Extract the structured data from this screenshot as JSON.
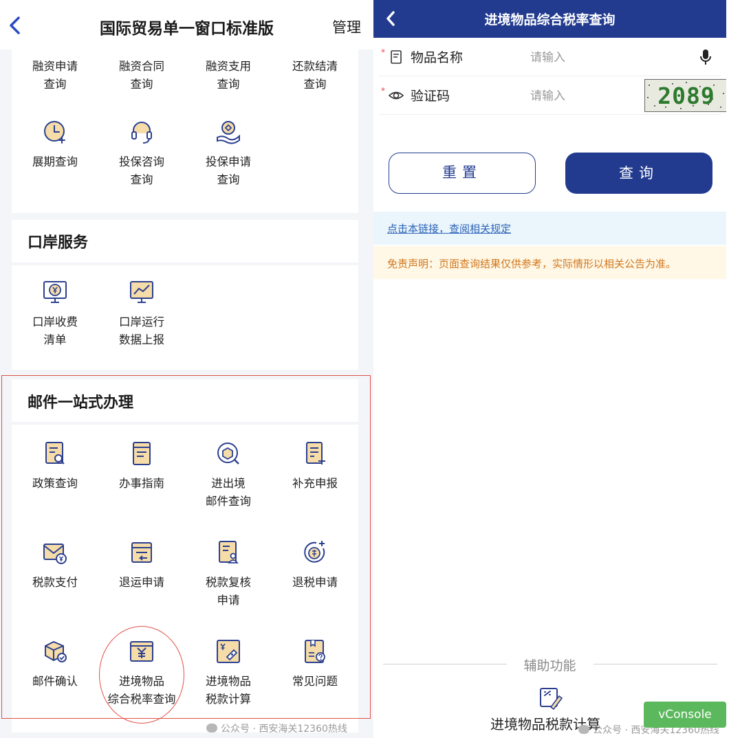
{
  "left": {
    "header": {
      "title": "国际贸易单一窗口标准版",
      "manage": "管理"
    },
    "finance": {
      "text_row": [
        "融资申请\n查询",
        "融资合同\n查询",
        "融资支用\n查询",
        "还款结清\n查询"
      ],
      "icon_row": [
        {
          "label": "展期查询",
          "icon": "clock-plus-icon"
        },
        {
          "label": "投保咨询\n查询",
          "icon": "headset-icon"
        },
        {
          "label": "投保申请\n查询",
          "icon": "hand-coin-icon"
        }
      ]
    },
    "port": {
      "title": "口岸服务",
      "items": [
        {
          "label": "口岸收费\n清单",
          "icon": "monitor-yen-icon"
        },
        {
          "label": "口岸运行\n数据上报",
          "icon": "monitor-chart-icon"
        }
      ]
    },
    "mail": {
      "title": "邮件一站式办理",
      "items": [
        {
          "label": "政策查询",
          "icon": "doc-search-icon"
        },
        {
          "label": "办事指南",
          "icon": "guide-doc-icon"
        },
        {
          "label": "进出境\n邮件查询",
          "icon": "package-search-icon"
        },
        {
          "label": "补充申报",
          "icon": "doc-plus-icon"
        },
        {
          "label": "税款支付",
          "icon": "mail-yen-icon"
        },
        {
          "label": "退运申请",
          "icon": "return-icon"
        },
        {
          "label": "税款复核\n申请",
          "icon": "doc-user-icon"
        },
        {
          "label": "退税申请",
          "icon": "refund-coin-icon"
        },
        {
          "label": "邮件确认",
          "icon": "package-check-icon"
        },
        {
          "label": "进境物品\n综合税率查询",
          "icon": "receipt-yen-icon"
        },
        {
          "label": "进境物品\n税款计算",
          "icon": "tax-calc-icon"
        },
        {
          "label": "常见问题",
          "icon": "faq-icon"
        }
      ]
    },
    "watermark": "公众号 · 西安海关12360热线"
  },
  "right": {
    "header": {
      "title": "进境物品综合税率查询"
    },
    "form": {
      "item_name": {
        "label": "物品名称",
        "placeholder": "请输入",
        "icon": "doc-icon",
        "required_mark": "*"
      },
      "captcha": {
        "label": "验证码",
        "placeholder": "请输入",
        "icon": "eye-icon",
        "required_mark": "*",
        "code": "2089"
      }
    },
    "buttons": {
      "reset": "重置",
      "query": "查询"
    },
    "link": "点击本链接，查阅相关规定",
    "disclaimer": "免责声明：页面查询结果仅供参考，实际情形以相关公告为准。",
    "aux": {
      "title": "辅助功能",
      "item": "进境物品税款计算",
      "icon": "tax-calc-icon"
    },
    "vconsole": "vConsole",
    "watermark": "公众号 · 西安海关12360热线"
  },
  "colors": {
    "primary": "#223b8f",
    "icon_blue": "#2b3f8f",
    "icon_fill": "#f5dca8",
    "highlight": "#e05048"
  }
}
